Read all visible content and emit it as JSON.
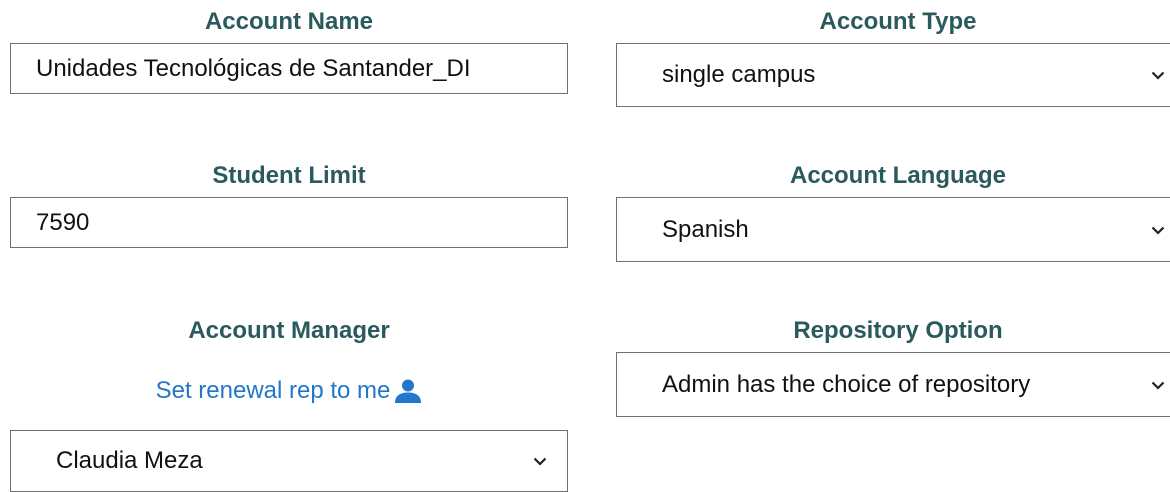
{
  "account_name": {
    "label": "Account Name",
    "value": "Unidades Tecnológicas de Santander_DI"
  },
  "account_type": {
    "label": "Account Type",
    "value": "single campus"
  },
  "student_limit": {
    "label": "Student Limit",
    "value": "7590"
  },
  "account_language": {
    "label": "Account Language",
    "value": "Spanish"
  },
  "account_manager": {
    "label": "Account Manager",
    "link_label": "Set renewal rep to me",
    "link_icon": "person-icon",
    "value": "Claudia Meza"
  },
  "repository_option": {
    "label": "Repository Option",
    "value": "Admin has the choice of repository"
  },
  "colors": {
    "label": "#2b5a5e",
    "link": "#2277cc",
    "border": "#6f6f6f"
  }
}
